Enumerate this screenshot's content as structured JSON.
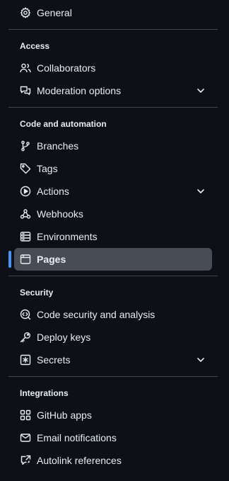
{
  "general": {
    "label": "General"
  },
  "sections": {
    "access": {
      "heading": "Access",
      "collaborators": "Collaborators",
      "moderation": "Moderation options"
    },
    "code_automation": {
      "heading": "Code and automation",
      "branches": "Branches",
      "tags": "Tags",
      "actions": "Actions",
      "webhooks": "Webhooks",
      "environments": "Environments",
      "pages": "Pages"
    },
    "security": {
      "heading": "Security",
      "code_security": "Code security and analysis",
      "deploy_keys": "Deploy keys",
      "secrets": "Secrets"
    },
    "integrations": {
      "heading": "Integrations",
      "github_apps": "GitHub apps",
      "email_notifications": "Email notifications",
      "autolink_references": "Autolink references"
    }
  },
  "colors": {
    "background": "#0d1117",
    "active_background": "#474c55",
    "active_indicator": "#4493f8",
    "divider": "#3d444d",
    "text": "#e6edf3"
  },
  "active_item": "Pages"
}
